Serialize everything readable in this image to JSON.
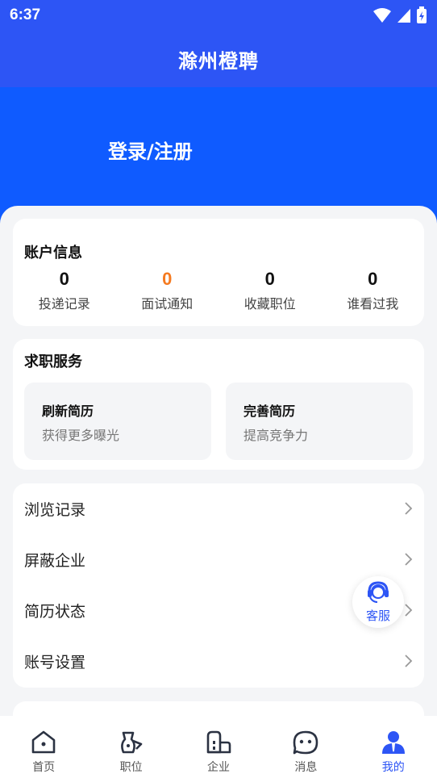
{
  "status_bar": {
    "time": "6:37"
  },
  "header": {
    "title": "滁州橙聘"
  },
  "hero": {
    "login_label": "登录/注册"
  },
  "account": {
    "title": "账户信息",
    "stats": [
      {
        "value": "0",
        "label": "投递记录",
        "highlight": false
      },
      {
        "value": "0",
        "label": "面试通知",
        "highlight": true
      },
      {
        "value": "0",
        "label": "收藏职位",
        "highlight": false
      },
      {
        "value": "0",
        "label": "谁看过我",
        "highlight": false
      }
    ]
  },
  "services": {
    "title": "求职服务",
    "items": [
      {
        "title": "刷新简历",
        "subtitle": "获得更多曝光"
      },
      {
        "title": "完善简历",
        "subtitle": "提高竞争力"
      }
    ]
  },
  "menu": {
    "items": [
      {
        "label": "浏览记录",
        "icon": "chevron-right-icon"
      },
      {
        "label": "屏蔽企业",
        "icon": "chevron-right-icon"
      },
      {
        "label": "简历状态",
        "icon": "chevron-right-icon"
      },
      {
        "label": "账号设置",
        "icon": "chevron-right-icon"
      }
    ]
  },
  "customer_service": {
    "label": "客服",
    "icon": "headset-agent-icon"
  },
  "tabbar": {
    "items": [
      {
        "label": "首页",
        "icon": "home-icon",
        "active": false
      },
      {
        "label": "职位",
        "icon": "briefcase-icon",
        "active": false
      },
      {
        "label": "企业",
        "icon": "building-icon",
        "active": false
      },
      {
        "label": "消息",
        "icon": "chat-icon",
        "active": false
      },
      {
        "label": "我的",
        "icon": "user-icon",
        "active": true
      }
    ]
  },
  "colors": {
    "brand_blue": "#2d55f5",
    "hero_blue": "#0f5bff",
    "highlight_orange": "#f57a20",
    "background": "#f4f5f7"
  }
}
